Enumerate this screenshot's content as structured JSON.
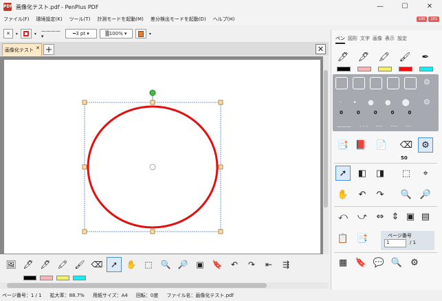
{
  "window": {
    "title": "画像化テスト.pdf - PenPlus PDF",
    "app_icon": "PDF",
    "minimize": "—",
    "maximize": "☐",
    "close": "✕"
  },
  "menu": [
    "ファイル(F)",
    "環境設定(K)",
    "ツール(T)",
    "計測モードを起動(M)",
    "差分検出モードを起動(D)",
    "ヘルプ(H)"
  ],
  "badges": [
    "100",
    "201"
  ],
  "toolbar": {
    "line_width": "3 pt",
    "opacity": "100%",
    "stroke_color": "#e02020",
    "fill_color": "#f07a20"
  },
  "tabs": {
    "doc_tab": "画像化テスト",
    "close": "✕",
    "add": "+",
    "panel_close": "✕"
  },
  "bottom": {
    "colors": [
      "#000000",
      "#f4b8b8",
      "#f0f070",
      "#20e8f0"
    ]
  },
  "panel": {
    "tabs": [
      "ペン",
      "図形",
      "文字",
      "画像",
      "表示",
      "設定"
    ],
    "pen_colors": [
      "#000000",
      "#f4b8b8",
      "#f0f070",
      "#f01010",
      "#20e8f0"
    ],
    "style_nums": [
      "0",
      "0",
      "0",
      "0",
      "0"
    ],
    "eraser_value": "50",
    "page_label": "ページ番号",
    "page_value": "1",
    "page_total": "/ 1"
  },
  "status": {
    "page": "ページ番号：1 / 1",
    "zoom": "拡大率：88.7%",
    "paper": "用紙サイズ：A4",
    "rotation": "回転：0度",
    "file": "ファイル名：画像化テスト.pdf"
  }
}
